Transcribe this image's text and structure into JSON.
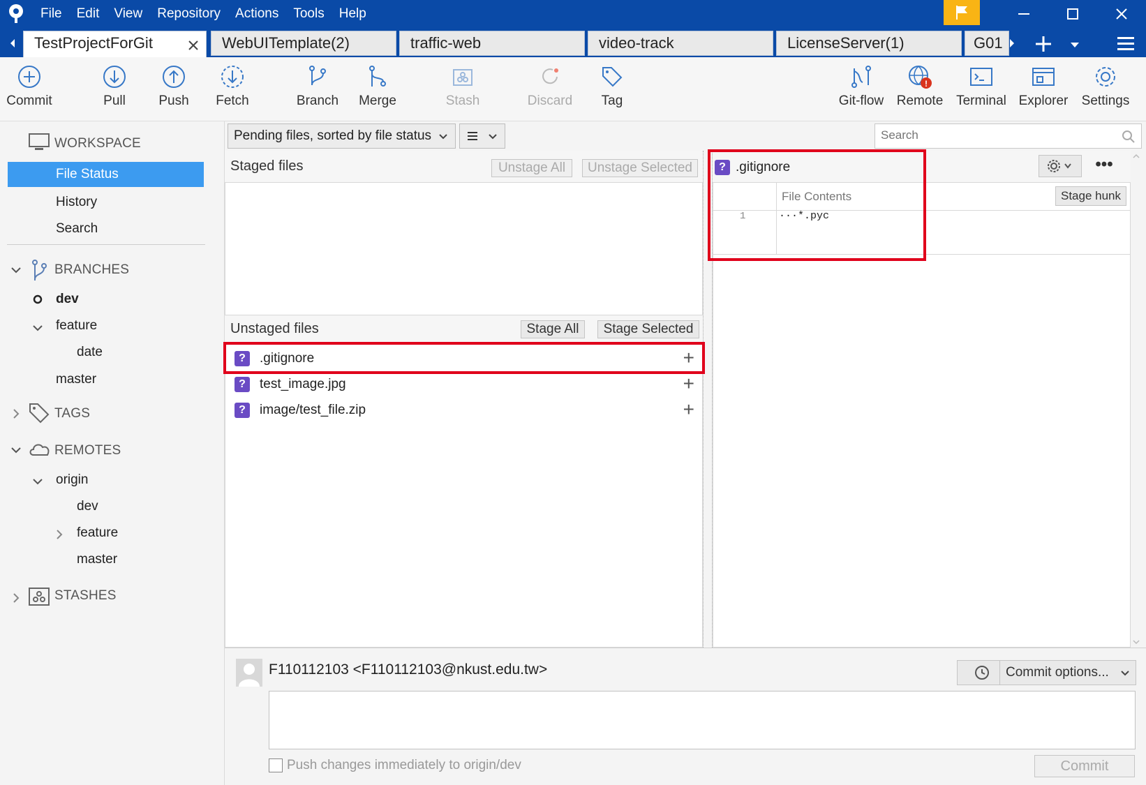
{
  "menu": [
    "File",
    "Edit",
    "View",
    "Repository",
    "Actions",
    "Tools",
    "Help"
  ],
  "tabs": [
    "TestProjectForGit",
    "WebUITemplate(2)",
    "traffic-web",
    "video-track",
    "LicenseServer(1)",
    "G01"
  ],
  "toolbar": {
    "commit": "Commit",
    "pull": "Pull",
    "push": "Push",
    "fetch": "Fetch",
    "branch": "Branch",
    "merge": "Merge",
    "stash": "Stash",
    "discard": "Discard",
    "tag": "Tag",
    "gitflow": "Git-flow",
    "remote": "Remote",
    "terminal": "Terminal",
    "explorer": "Explorer",
    "settings": "Settings"
  },
  "sidebar": {
    "workspace": "WORKSPACE",
    "file_status": "File Status",
    "history": "History",
    "search": "Search",
    "branches": "BRANCHES",
    "branch_dev": "dev",
    "branch_feature": "feature",
    "branch_date": "date",
    "branch_master": "master",
    "tags": "TAGS",
    "remotes": "REMOTES",
    "origin": "origin",
    "remote_dev": "dev",
    "remote_feature": "feature",
    "remote_master": "master",
    "stashes": "STASHES"
  },
  "filter": {
    "sort_label": "Pending files, sorted by file status",
    "search_placeholder": "Search"
  },
  "staged": {
    "title": "Staged files",
    "unstage_all": "Unstage All",
    "unstage_selected": "Unstage Selected"
  },
  "unstaged": {
    "title": "Unstaged files",
    "stage_all": "Stage All",
    "stage_selected": "Stage Selected",
    "files": [
      ".gitignore",
      "test_image.jpg",
      "image/test_file.zip"
    ]
  },
  "diff": {
    "filename": ".gitignore",
    "header": "File Contents",
    "stage_hunk": "Stage hunk",
    "line_no": "1",
    "line_text": "···*.pyc"
  },
  "commit": {
    "author": "F110112103 <F110112103@nkust.edu.tw>",
    "options": "Commit options...",
    "push_label": "Push changes immediately to origin/dev",
    "button": "Commit"
  },
  "colors": {
    "titlebar": "#0a4aa7",
    "selection": "#3c9bf0",
    "highlight": "#e0001b",
    "untracked_icon": "#6a4bc4"
  }
}
